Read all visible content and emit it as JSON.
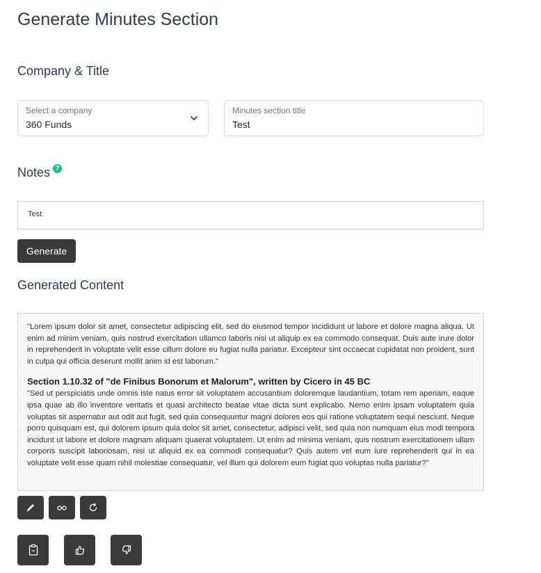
{
  "page": {
    "title": "Generate Minutes Section"
  },
  "company_section": {
    "title": "Company & Title",
    "company_select": {
      "label": "Select a company",
      "value": "360 Funds"
    },
    "minutes_title": {
      "label": "Minutes section title",
      "value": "Test"
    }
  },
  "notes_section": {
    "title": "Notes",
    "help_glyph": "?",
    "notes_value": "Test",
    "generate_label": "Generate"
  },
  "generated_section": {
    "title": "Generated Content",
    "paragraph_1": "\"Lorem ipsum dolor sit amet, consectetur adipiscing elit, sed do eiusmod tempor incididunt ut labore et dolore magna aliqua. Ut enim ad minim veniam, quis nostrud exercitation ullamco laboris nisi ut aliquip ex ea commodo consequat. Duis aute irure dolor in reprehenderit in voluptate velit esse cillum dolore eu fugiat nulla pariatur. Excepteur sint occaecat cupidatat non proident, sunt in culpa qui officia deserunt mollit anim id est laborum.\"",
    "heading": "Section 1.10.32 of \"de Finibus Bonorum et Malorum\", written by Cicero in 45 BC",
    "paragraph_2": "\"Sed ut perspiciatis unde omnis iste natus error sit voluptatem accusantium doloremque laudantium, totam rem aperiam, eaque ipsa quae ab illo inventore veritatis et quasi architecto beatae vitae dicta sunt explicabo. Nemo enim ipsam voluptatem quia voluptas sit aspernatur aut odit aut fugit, sed quia consequuntur magni dolores eos qui ratione voluptatem sequi nesciunt. Neque porro quisquam est, qui dolorem ipsum quia dolor sit amet, consectetur, adipisci velit, sed quia non numquam eius modi tempora incidunt ut labore et dolore magnam aliquam quaerat voluptatem. Ut enim ad minima veniam, quis nostrum exercitationem ullam corporis suscipit laboriosam, nisi ut aliquid ex ea commodi consequatur? Quis autem vel eum iure reprehenderit qui in ea voluptate velit esse quam nihil molestiae consequatur, vel illum qui dolorem eum fugiat quo voluptas nulla pariatur?\""
  },
  "action_buttons": {
    "row_1": [
      "pencil-icon",
      "glasses-icon",
      "refresh-icon"
    ],
    "row_2": [
      "clipboard-icon",
      "thumbs-up-icon",
      "thumbs-down-icon"
    ]
  },
  "colors": {
    "button_dark": "#3a3a3a",
    "help_badge": "#1abc9c",
    "heading_text": "#2c3e50"
  }
}
